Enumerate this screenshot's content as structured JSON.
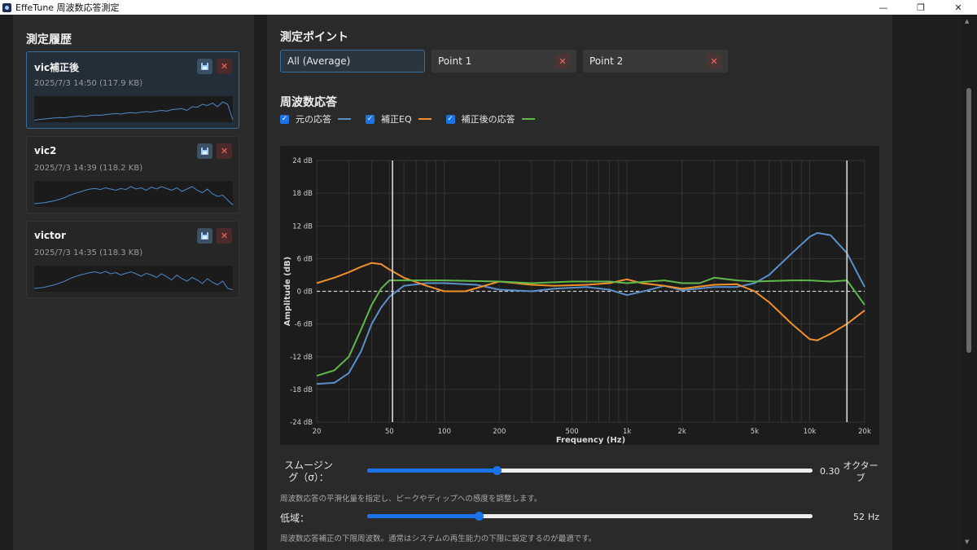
{
  "window": {
    "title": "EffeTune 周波数応答測定",
    "controls": [
      "—",
      "❐",
      "✕"
    ]
  },
  "sidebar": {
    "title": "測定履歴",
    "items": [
      {
        "name": "vic補正後",
        "meta": "2025/7/3 14:50 (117.9 KB)",
        "active": true,
        "trace": [
          0.95,
          0.92,
          0.9,
          0.88,
          0.86,
          0.84,
          0.85,
          0.82,
          0.8,
          0.78,
          0.8,
          0.76,
          0.74,
          0.75,
          0.72,
          0.7,
          0.68,
          0.7,
          0.66,
          0.64,
          0.66,
          0.62,
          0.6,
          0.62,
          0.58,
          0.55,
          0.58,
          0.52,
          0.5,
          0.48,
          0.55,
          0.4,
          0.42,
          0.3,
          0.35,
          0.25,
          0.4,
          0.2,
          0.3,
          0.95
        ]
      },
      {
        "name": "vic2",
        "meta": "2025/7/3 14:39 (118.2 KB)",
        "active": false,
        "trace": [
          0.9,
          0.88,
          0.86,
          0.82,
          0.78,
          0.72,
          0.65,
          0.55,
          0.48,
          0.42,
          0.35,
          0.3,
          0.28,
          0.32,
          0.25,
          0.3,
          0.35,
          0.28,
          0.32,
          0.2,
          0.3,
          0.25,
          0.35,
          0.22,
          0.3,
          0.2,
          0.28,
          0.35,
          0.25,
          0.4,
          0.3,
          0.2,
          0.35,
          0.45,
          0.3,
          0.5,
          0.6,
          0.55,
          0.75,
          0.95
        ]
      },
      {
        "name": "victor",
        "meta": "2025/7/3 14:35 (118.3 KB)",
        "active": false,
        "trace": [
          0.9,
          0.88,
          0.85,
          0.8,
          0.75,
          0.68,
          0.6,
          0.5,
          0.42,
          0.35,
          0.3,
          0.25,
          0.22,
          0.28,
          0.2,
          0.3,
          0.25,
          0.35,
          0.28,
          0.22,
          0.3,
          0.4,
          0.28,
          0.35,
          0.45,
          0.3,
          0.42,
          0.55,
          0.35,
          0.5,
          0.6,
          0.45,
          0.55,
          0.7,
          0.5,
          0.65,
          0.75,
          0.6,
          0.9,
          0.95
        ]
      }
    ],
    "save_icon": "save-icon",
    "delete_icon": "close-icon"
  },
  "points": {
    "title": "測定ポイント",
    "tabs": [
      {
        "label": "All (Average)",
        "selected": true,
        "closable": false
      },
      {
        "label": "Point 1",
        "selected": false,
        "closable": true
      },
      {
        "label": "Point 2",
        "selected": false,
        "closable": true
      }
    ],
    "close_glyph": "✕"
  },
  "response": {
    "title": "周波数応答",
    "legend": [
      {
        "label": "元の応答",
        "color": "#5b8fc9",
        "checked": true
      },
      {
        "label": "補正EQ",
        "color": "#f0902a",
        "checked": true
      },
      {
        "label": "補正後の応答",
        "color": "#5fb84a",
        "checked": true
      }
    ]
  },
  "chart_data": {
    "type": "line",
    "xlabel": "Frequency (Hz)",
    "ylabel": "Amplitude (dB)",
    "x_scale": "log",
    "xlim": [
      20,
      20000
    ],
    "ylim": [
      -24,
      24
    ],
    "x_ticks": [
      {
        "value": 20,
        "label": "20"
      },
      {
        "value": 50,
        "label": "50"
      },
      {
        "value": 100,
        "label": "100"
      },
      {
        "value": 200,
        "label": "200"
      },
      {
        "value": 500,
        "label": "500"
      },
      {
        "value": 1000,
        "label": "1k"
      },
      {
        "value": 2000,
        "label": "2k"
      },
      {
        "value": 5000,
        "label": "5k"
      },
      {
        "value": 10000,
        "label": "10k"
      },
      {
        "value": 20000,
        "label": "20k"
      }
    ],
    "y_ticks": [
      {
        "value": 24,
        "label": "24 dB"
      },
      {
        "value": 18,
        "label": "18 dB"
      },
      {
        "value": 12,
        "label": "12 dB"
      },
      {
        "value": 6,
        "label": "6 dB"
      },
      {
        "value": 0,
        "label": "0 dB"
      },
      {
        "value": -6,
        "label": "-6 dB"
      },
      {
        "value": -12,
        "label": "-12 dB"
      },
      {
        "value": -18,
        "label": "-18 dB"
      },
      {
        "value": -24,
        "label": "-24 dB"
      }
    ],
    "grid": true,
    "zero_line": true,
    "markers_hz": [
      52,
      16000
    ],
    "series": [
      {
        "color": "#5b8fc9",
        "points": [
          [
            20,
            -17
          ],
          [
            25,
            -16.8
          ],
          [
            30,
            -15
          ],
          [
            35,
            -11
          ],
          [
            40,
            -6
          ],
          [
            45,
            -3
          ],
          [
            50,
            -1
          ],
          [
            60,
            1
          ],
          [
            80,
            1.5
          ],
          [
            100,
            1.5
          ],
          [
            150,
            1.2
          ],
          [
            200,
            0.3
          ],
          [
            300,
            0
          ],
          [
            400,
            0.5
          ],
          [
            600,
            0.8
          ],
          [
            800,
            0.3
          ],
          [
            1000,
            -0.7
          ],
          [
            1300,
            0.2
          ],
          [
            1600,
            1
          ],
          [
            2000,
            0.2
          ],
          [
            3000,
            0.8
          ],
          [
            4000,
            0.8
          ],
          [
            5000,
            1.5
          ],
          [
            6000,
            3
          ],
          [
            8000,
            7
          ],
          [
            10000,
            10
          ],
          [
            11000,
            10.7
          ],
          [
            13000,
            10.3
          ],
          [
            16000,
            7
          ],
          [
            20000,
            0.8
          ]
        ]
      },
      {
        "color": "#f0902a",
        "points": [
          [
            20,
            1.5
          ],
          [
            25,
            2.5
          ],
          [
            30,
            3.5
          ],
          [
            35,
            4.5
          ],
          [
            40,
            5.2
          ],
          [
            45,
            5
          ],
          [
            50,
            4
          ],
          [
            60,
            2.5
          ],
          [
            80,
            1
          ],
          [
            100,
            0
          ],
          [
            130,
            0
          ],
          [
            200,
            1.8
          ],
          [
            300,
            1.2
          ],
          [
            400,
            1
          ],
          [
            600,
            1.2
          ],
          [
            800,
            1.5
          ],
          [
            1000,
            2.2
          ],
          [
            1200,
            1.5
          ],
          [
            1600,
            1
          ],
          [
            2000,
            0.5
          ],
          [
            3000,
            1.2
          ],
          [
            4000,
            1.3
          ],
          [
            5000,
            0
          ],
          [
            6000,
            -2
          ],
          [
            8000,
            -6
          ],
          [
            10000,
            -8.8
          ],
          [
            11000,
            -9
          ],
          [
            13000,
            -7.8
          ],
          [
            16000,
            -6
          ],
          [
            20000,
            -3.5
          ]
        ]
      },
      {
        "color": "#5fb84a",
        "points": [
          [
            20,
            -15.5
          ],
          [
            25,
            -14.5
          ],
          [
            30,
            -12
          ],
          [
            35,
            -7
          ],
          [
            40,
            -2.5
          ],
          [
            45,
            0.5
          ],
          [
            50,
            2
          ],
          [
            60,
            2
          ],
          [
            100,
            2
          ],
          [
            200,
            1.8
          ],
          [
            300,
            1.5
          ],
          [
            500,
            1.8
          ],
          [
            800,
            1.8
          ],
          [
            1000,
            1.5
          ],
          [
            1300,
            1.8
          ],
          [
            1600,
            2
          ],
          [
            2000,
            1.5
          ],
          [
            2500,
            1.5
          ],
          [
            3000,
            2.5
          ],
          [
            4000,
            2
          ],
          [
            5000,
            1.8
          ],
          [
            8000,
            2
          ],
          [
            10000,
            2
          ],
          [
            13000,
            1.8
          ],
          [
            16000,
            2
          ],
          [
            20000,
            -2.5
          ]
        ]
      }
    ]
  },
  "smoothing": {
    "label": "スムージング（σ）：",
    "value": 0.3,
    "value_text": "0.30",
    "unit": "オクターブ",
    "fraction": 0.29,
    "help": "周波数応答の平滑化量を指定し、ピークやディップへの感度を調整します。"
  },
  "low_band": {
    "label": "低域：",
    "value_text": "52",
    "unit": "Hz",
    "fraction": 0.25,
    "help": "周波数応答補正の下限周波数。通常はシステムの再生能力の下限に設定するのが最適です。"
  }
}
